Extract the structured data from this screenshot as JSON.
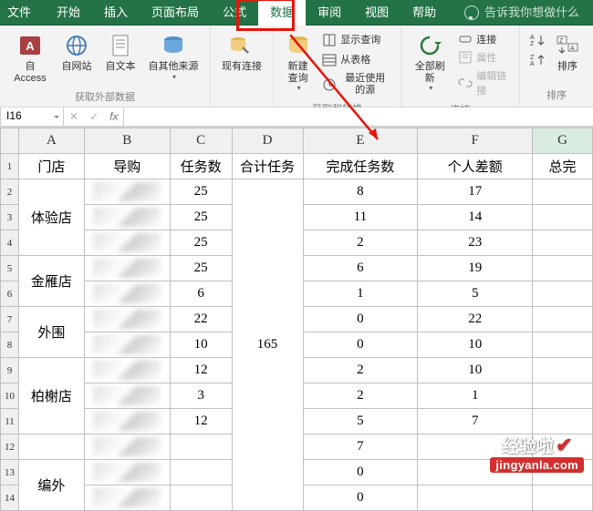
{
  "tabs": {
    "items": [
      "文件",
      "开始",
      "插入",
      "页面布局",
      "公式",
      "数据",
      "审阅",
      "视图",
      "帮助"
    ],
    "tell": "告诉我你想做什么",
    "active_index": 5
  },
  "ribbon": {
    "external": {
      "access": "自 Access",
      "web": "自网站",
      "text": "自文本",
      "other": "自其他来源",
      "existing": "现有连接",
      "label": "获取外部数据"
    },
    "getxform": {
      "newquery": "新建\n查询",
      "show": "显示查询",
      "table": "从表格",
      "recent": "最近使用的源",
      "label": "获取和转换"
    },
    "connections": {
      "refresh": "全部刷新",
      "connect": "连接",
      "props": "属性",
      "editlink": "编辑链接",
      "label": "连接"
    },
    "sort": {
      "az": "A↓Z",
      "za": "Z↓A",
      "sort": "排序",
      "label": "排序"
    }
  },
  "namebox": "I16",
  "columns": [
    "A",
    "B",
    "C",
    "D",
    "E",
    "F",
    "G"
  ],
  "rows": [
    "1",
    "2",
    "3",
    "4",
    "5",
    "6",
    "7",
    "8",
    "9",
    "10",
    "11",
    "12",
    "13",
    "14"
  ],
  "headers": {
    "A": "门店",
    "B": "导购",
    "C": "任务数",
    "D": "合计任务",
    "E": "完成任务数",
    "F": "个人差额",
    "G": "总完"
  },
  "merge_A": [
    {
      "start": 2,
      "span": 3,
      "text": "体验店"
    },
    {
      "start": 5,
      "span": 2,
      "text": "金雁店"
    },
    {
      "start": 7,
      "span": 2,
      "text": "外围"
    },
    {
      "start": 9,
      "span": 3,
      "text": "柏榭店"
    },
    {
      "start": 12,
      "span": 1,
      "text": ""
    },
    {
      "start": 13,
      "span": 2,
      "text": "编外"
    }
  ],
  "col_C": [
    "25",
    "25",
    "25",
    "25",
    "6",
    "22",
    "10",
    "12",
    "3",
    "12",
    "",
    "",
    ""
  ],
  "col_D": {
    "start": 2,
    "span": 13,
    "text": "165"
  },
  "col_E": [
    "8",
    "11",
    "2",
    "6",
    "1",
    "0",
    "0",
    "2",
    "2",
    "5",
    "7",
    "0",
    "0"
  ],
  "col_F": [
    "17",
    "14",
    "23",
    "19",
    "5",
    "22",
    "10",
    "10",
    "1",
    "7",
    "",
    "",
    ""
  ],
  "watermark": {
    "top": "经验啦",
    "bot": "jingyanla.com"
  }
}
